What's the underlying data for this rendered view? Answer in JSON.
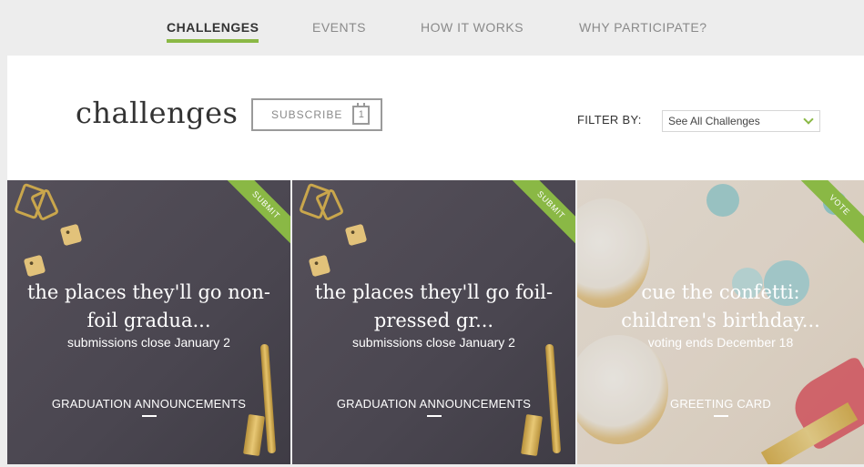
{
  "nav": {
    "items": [
      {
        "label": "CHALLENGES",
        "active": true
      },
      {
        "label": "EVENTS",
        "active": false
      },
      {
        "label": "HOW IT WORKS",
        "active": false
      },
      {
        "label": "WHY PARTICIPATE?",
        "active": false
      }
    ]
  },
  "header": {
    "title": "challenges",
    "subscribe_label": "SUBSCRIBE",
    "calendar_day": "1",
    "filter_label": "FILTER BY:",
    "filter_value": "See All Challenges"
  },
  "cards": [
    {
      "ribbon": "SUBMIT",
      "title_line1": "the places they'll go non-",
      "title_line2": "foil gradua...",
      "subtitle": "submissions close January 2",
      "category": "GRADUATION ANNOUNCEMENTS"
    },
    {
      "ribbon": "SUBMIT",
      "title_line1": "the places they'll go foil-",
      "title_line2": "pressed gr...",
      "subtitle": "submissions close January 2",
      "category": "GRADUATION ANNOUNCEMENTS"
    },
    {
      "ribbon": "VOTE",
      "title_line1": "cue the confetti:",
      "title_line2": "children's birthday...",
      "subtitle": "voting ends December 18",
      "category": "GREETING CARD"
    }
  ],
  "colors": {
    "accent": "#8ab845",
    "text_dark": "#333333",
    "text_muted": "#8a8a8a"
  }
}
